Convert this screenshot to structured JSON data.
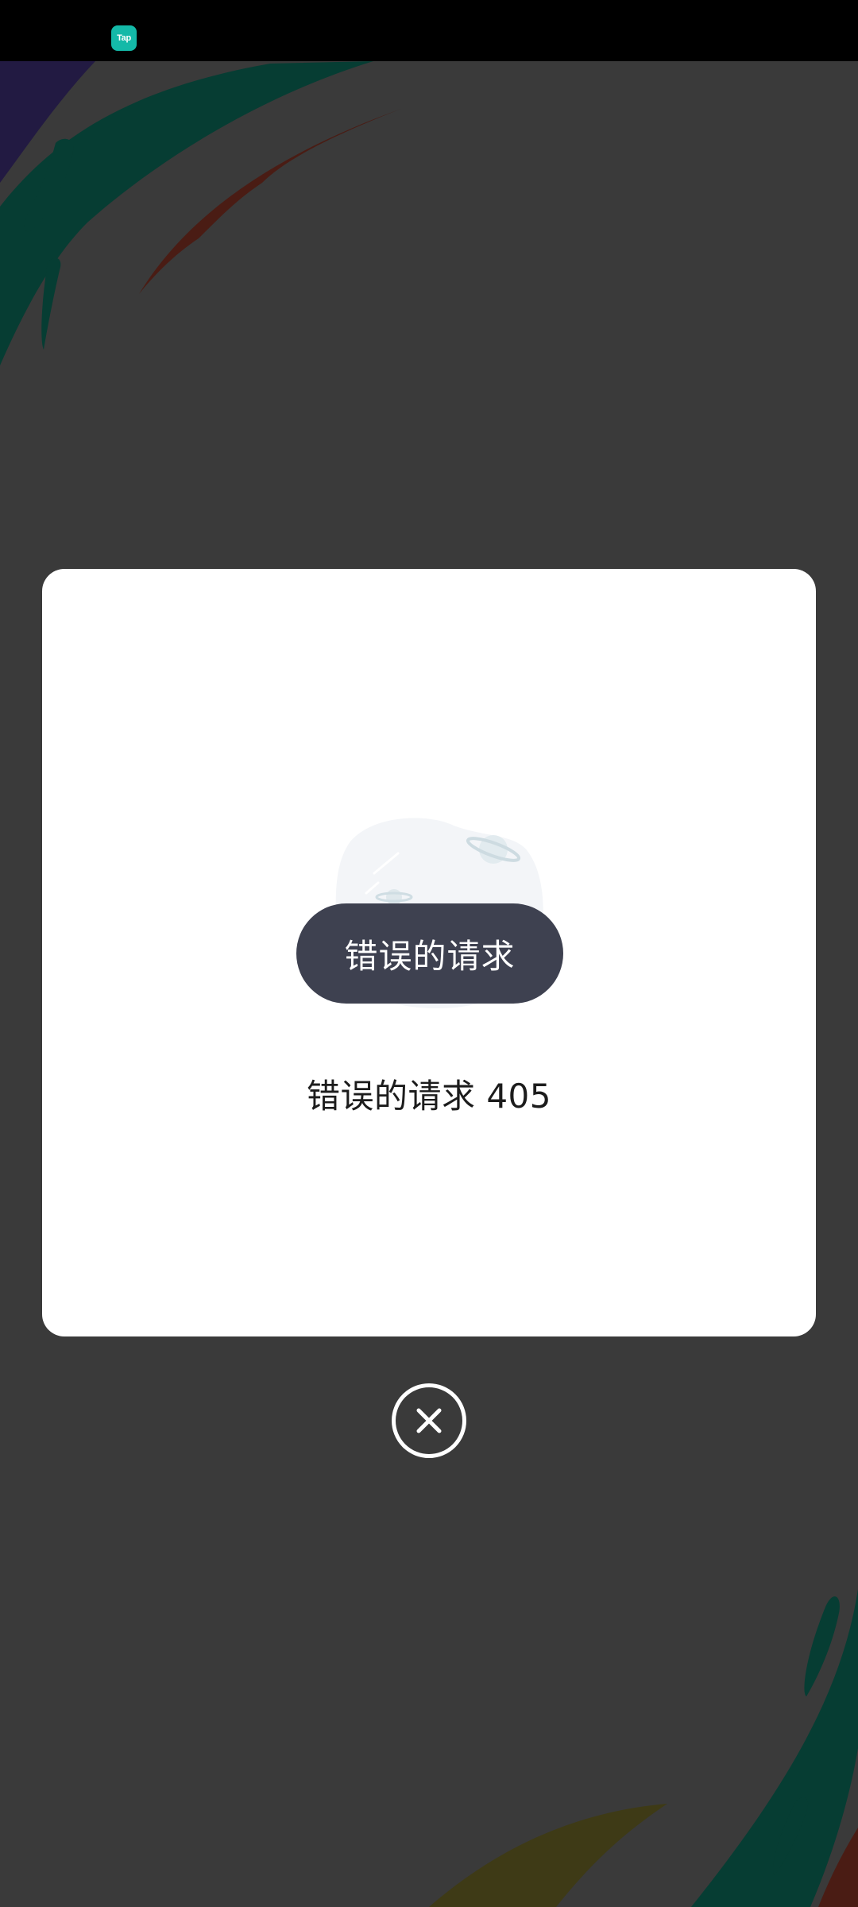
{
  "status_bar": {
    "app_badge_text": "Tap",
    "background_color": "#000000",
    "badge_color": "#14b9a8"
  },
  "modal": {
    "button_label": "错误的请求",
    "message": "错误的请求 405",
    "illustration_icon": "empty-planet-illustration-icon",
    "card_color": "#ffffff",
    "button_color": "#3e4150"
  },
  "close": {
    "icon": "close-icon",
    "color": "#ffffff"
  },
  "theme": {
    "overlay_color": "#3a3a3a",
    "swoosh_teal": "#063d33",
    "swoosh_red": "#4a1c14",
    "swoosh_purple": "#221a42",
    "swoosh_olive": "#3e3a16"
  }
}
